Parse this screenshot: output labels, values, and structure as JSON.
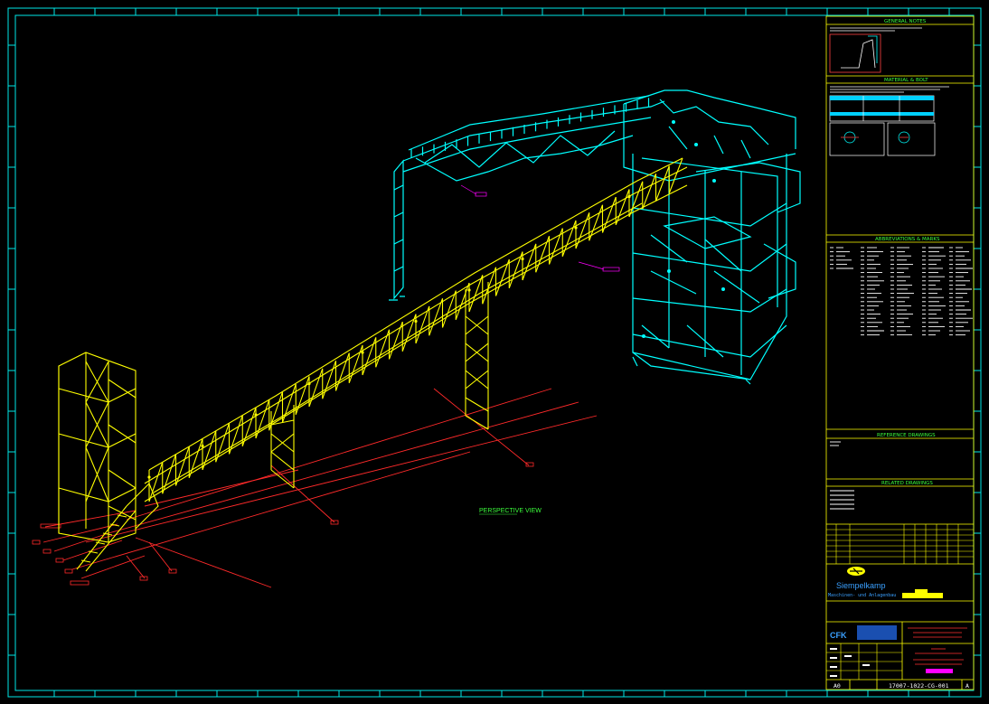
{
  "drawing": {
    "view_label": "PERSPECTIVE VIEW",
    "sheet_size": "A0",
    "drawing_number": "17007-1022-CG-001",
    "revision": "A"
  },
  "title_block": {
    "general_notes": {
      "title": "GENERAL NOTES"
    },
    "material_bolt": {
      "title": "MATERIAL & BOLT"
    },
    "abbreviations": {
      "title": "ABBREVIATIONS & MARKS"
    },
    "reference_drawings": {
      "title": "REFERENCE DRAWINGS"
    },
    "related_drawings": {
      "title": "RELATED DRAWINGS"
    },
    "company": {
      "name": "Siempelkamp",
      "subtitle": "Maschinen- und Anlagenbau"
    },
    "contractor_logo": "CFK"
  },
  "colors": {
    "frame": "#00e6e6",
    "conveyor": "#ffff00",
    "tower": "#00ffff",
    "dimension": "#ff2a2a",
    "text_green": "#3cff3c",
    "magenta": "#ff00ff",
    "blue_logo": "#3aa0ff"
  }
}
